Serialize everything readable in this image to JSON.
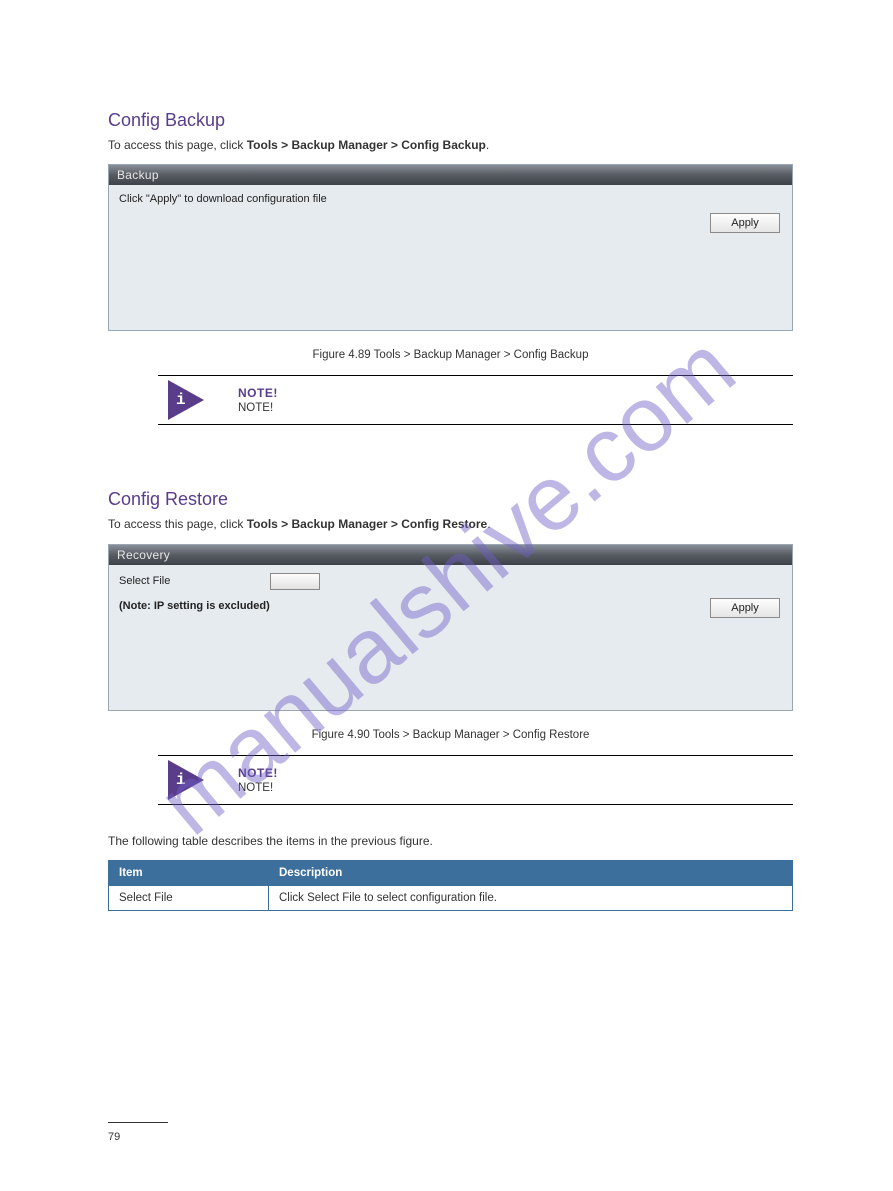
{
  "watermark": "manualshive.com",
  "sectionA": {
    "title": "Config Backup",
    "intro_a": "To access this page, click ",
    "intro_b": "Tools > Backup Manager > Config Backup",
    "intro_c": "."
  },
  "panelBackup": {
    "header": "Backup",
    "desc": "Click \"Apply\" to download configuration file",
    "apply": "Apply"
  },
  "figureA": {
    "caption": "Figure 4.89 Tools > Backup Manager > Config Backup"
  },
  "noteA": {
    "title": "NOTE!",
    "text": "NOTE!"
  },
  "sectionB": {
    "title": "Config Restore",
    "intro_a": "To access this page, click ",
    "intro_b": "Tools > Backup Manager > Config Restore",
    "intro_c": "."
  },
  "panelRecovery": {
    "header": "Recovery",
    "selectFile": "Select File",
    "note": "(Note: IP setting is excluded)",
    "apply": "Apply"
  },
  "figureB": {
    "caption": "Figure 4.90 Tools > Backup Manager > Config Restore"
  },
  "noteB": {
    "title": "NOTE!",
    "text": "NOTE!"
  },
  "tableIntro": "The following table describes the items in the previous figure.",
  "table": {
    "headers": [
      "Item",
      "Description"
    ],
    "rows": [
      [
        "Select File",
        "Click Select File to select configuration file."
      ]
    ]
  },
  "pageNum": "79"
}
